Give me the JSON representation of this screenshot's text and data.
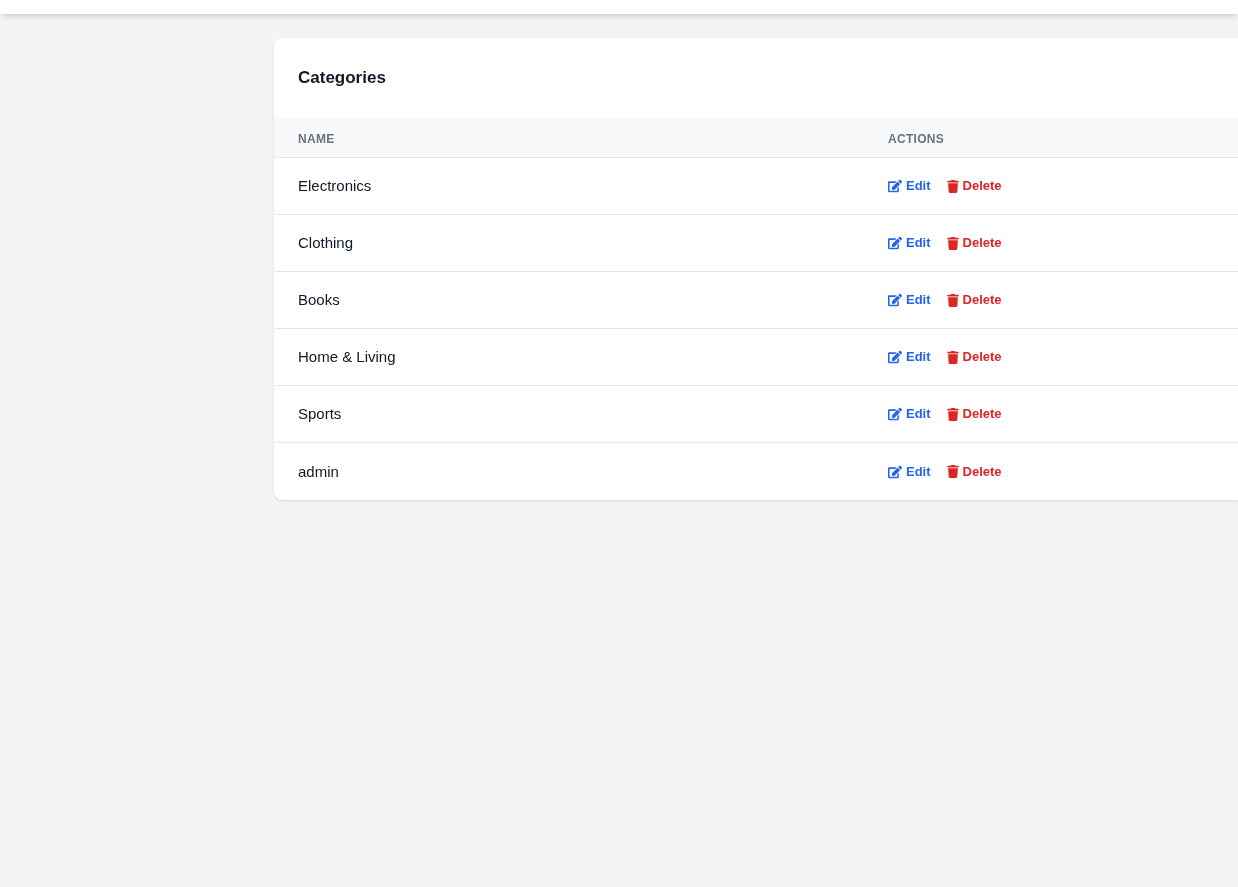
{
  "card": {
    "title": "Categories"
  },
  "table": {
    "columns": [
      "NAME",
      "ACTIONS"
    ],
    "rows": [
      {
        "name": "Electronics",
        "actions": [
          "Edit",
          "Delete"
        ]
      },
      {
        "name": "Clothing",
        "actions": [
          "Edit",
          "Delete"
        ]
      },
      {
        "name": "Books",
        "actions": [
          "Edit",
          "Delete"
        ]
      },
      {
        "name": "Home & Living",
        "actions": [
          "Edit",
          "Delete"
        ]
      },
      {
        "name": "Sports",
        "actions": [
          "Edit",
          "Delete"
        ]
      },
      {
        "name": "admin",
        "actions": [
          "Edit",
          "Delete"
        ]
      }
    ]
  }
}
